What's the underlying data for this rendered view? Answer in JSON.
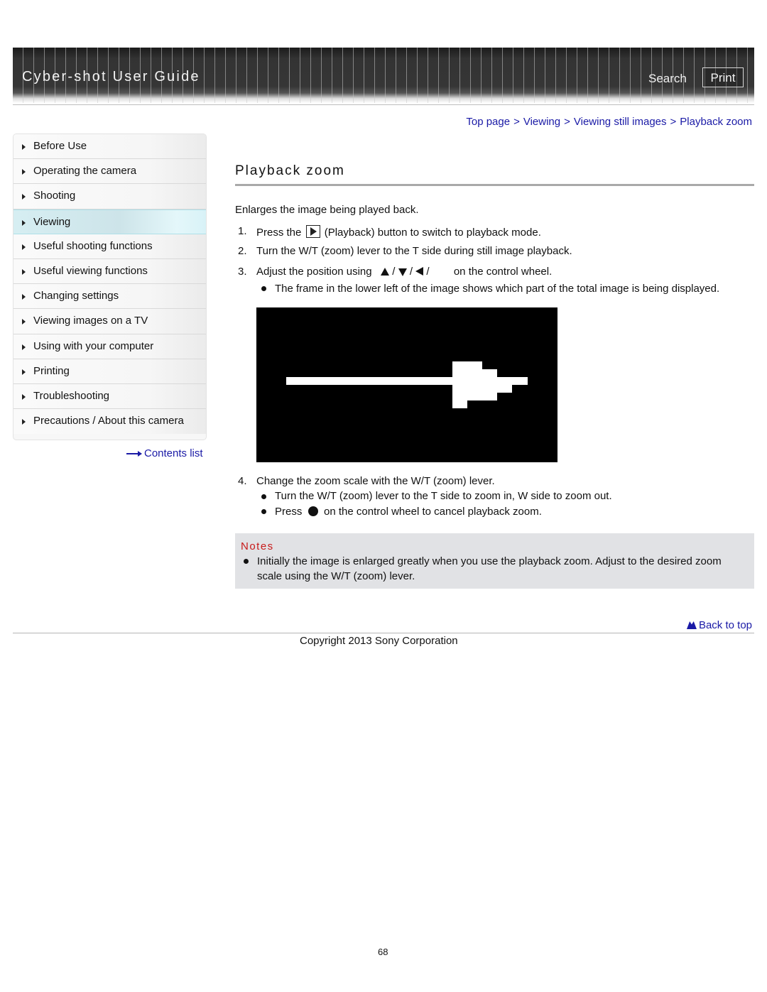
{
  "header": {
    "title": "Cyber-shot User Guide",
    "search_label": "Search",
    "print_label": "Print"
  },
  "breadcrumb": [
    {
      "label": "Top page"
    },
    {
      "label": "Viewing"
    },
    {
      "label": "Viewing still images"
    },
    {
      "label": "Playback zoom"
    }
  ],
  "breadcrumb_separator": ">",
  "sidebar": {
    "items": [
      {
        "label": "Before Use",
        "active": false
      },
      {
        "label": "Operating the camera",
        "active": false
      },
      {
        "label": "Shooting",
        "active": false
      },
      {
        "label": "Viewing",
        "active": true
      },
      {
        "label": "Useful shooting functions",
        "active": false
      },
      {
        "label": "Useful viewing functions",
        "active": false
      },
      {
        "label": "Changing settings",
        "active": false
      },
      {
        "label": "Viewing images on a TV",
        "active": false
      },
      {
        "label": "Using with your computer",
        "active": false
      },
      {
        "label": "Printing",
        "active": false
      },
      {
        "label": "Troubleshooting",
        "active": false
      },
      {
        "label": "Precautions / About this camera",
        "active": false
      }
    ],
    "contents_link": "Contents list"
  },
  "main": {
    "title": "Playback zoom",
    "intro": "Enlarges the image being played back.",
    "steps": [
      {
        "num": "1.",
        "pre": "Press the",
        "icon": "playback-icon",
        "post": "(Playback) button to switch to playback mode."
      },
      {
        "num": "2.",
        "text": "Turn the W/T (zoom) lever to the T side during still image playback."
      },
      {
        "num": "3.",
        "pre": "Adjust the position using",
        "sep": "/",
        "post": "on the control wheel.",
        "bullets": [
          "The frame in the lower left of the image shows which part of the total image is being displayed."
        ]
      },
      {
        "num": "4.",
        "text": "Change the zoom scale with the W/T (zoom) lever.",
        "bullets": [
          "Turn the W/T (zoom) lever to the T side to zoom in, W side to zoom out."
        ],
        "press_bullet": {
          "pre": "Press",
          "post": "on the control wheel to cancel playback zoom."
        }
      }
    ],
    "notes": {
      "title": "Notes",
      "items": [
        "Initially the image is enlarged greatly when you use the playback zoom. Adjust to the desired zoom",
        "scale using the W/T (zoom) lever."
      ]
    }
  },
  "footer": {
    "back_to_top": "Back to top",
    "copyright": "Copyright 2013 Sony Corporation",
    "page_number": "68"
  },
  "colors": {
    "link": "#1a1aa6",
    "notes_title": "#c81a1a",
    "notes_bg": "#e1e2e5",
    "header_bg": "#333333"
  }
}
